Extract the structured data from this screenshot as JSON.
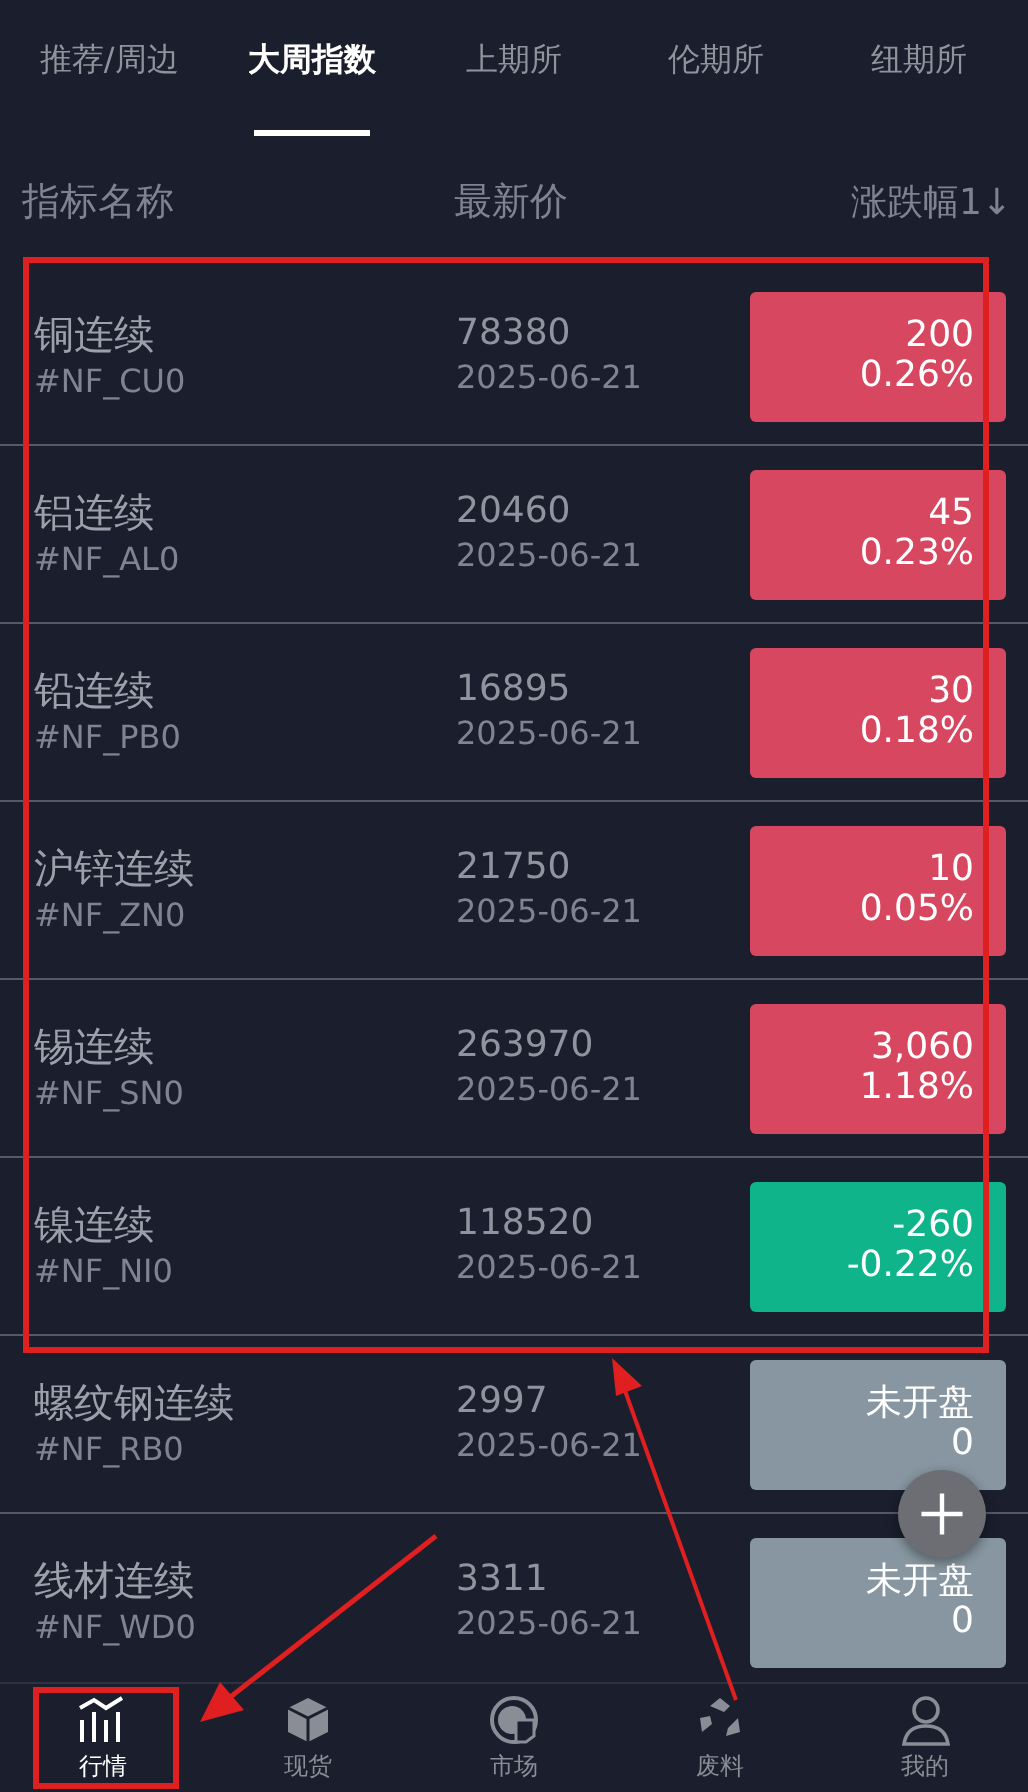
{
  "tabs": [
    {
      "label": "推荐/周边",
      "selected": false
    },
    {
      "label": "大周指数",
      "selected": true
    },
    {
      "label": "上期所",
      "selected": false
    },
    {
      "label": "伦期所",
      "selected": false
    },
    {
      "label": "纽期所",
      "selected": false
    }
  ],
  "columns": [
    "指标名称",
    "最新价",
    "涨跌幅1↓"
  ],
  "rows": [
    {
      "name": "铜连续",
      "code": "#NF_CU0",
      "price": "78380",
      "date": "2025-06-21",
      "change": "200",
      "percent": "0.26%",
      "kind": "up"
    },
    {
      "name": "铝连续",
      "code": "#NF_AL0",
      "price": "20460",
      "date": "2025-06-21",
      "change": "45",
      "percent": "0.23%",
      "kind": "up"
    },
    {
      "name": "铅连续",
      "code": "#NF_PB0",
      "price": "16895",
      "date": "2025-06-21",
      "change": "30",
      "percent": "0.18%",
      "kind": "up"
    },
    {
      "name": "沪锌连续",
      "code": "#NF_ZN0",
      "price": "21750",
      "date": "2025-06-21",
      "change": "10",
      "percent": "0.05%",
      "kind": "up"
    },
    {
      "name": "锡连续",
      "code": "#NF_SN0",
      "price": "263970",
      "date": "2025-06-21",
      "change": "3,060",
      "percent": "1.18%",
      "kind": "up"
    },
    {
      "name": "镍连续",
      "code": "#NF_NI0",
      "price": "118520",
      "date": "2025-06-21",
      "change": "-260",
      "percent": "-0.22%",
      "kind": "down"
    },
    {
      "name": "螺纹钢连续",
      "code": "#NF_RB0",
      "price": "2997",
      "date": "2025-06-21",
      "change": "未开盘",
      "percent": "0",
      "kind": "closed"
    },
    {
      "name": "线材连续",
      "code": "#NF_WD0",
      "price": "3311",
      "date": "2025-06-21",
      "change": "未开盘",
      "percent": "0",
      "kind": "closed"
    }
  ],
  "nav": [
    {
      "label": "行情",
      "selected": true
    },
    {
      "label": "现货",
      "selected": false
    },
    {
      "label": "市场",
      "selected": false
    },
    {
      "label": "废料",
      "selected": false
    },
    {
      "label": "我的",
      "selected": false
    }
  ]
}
